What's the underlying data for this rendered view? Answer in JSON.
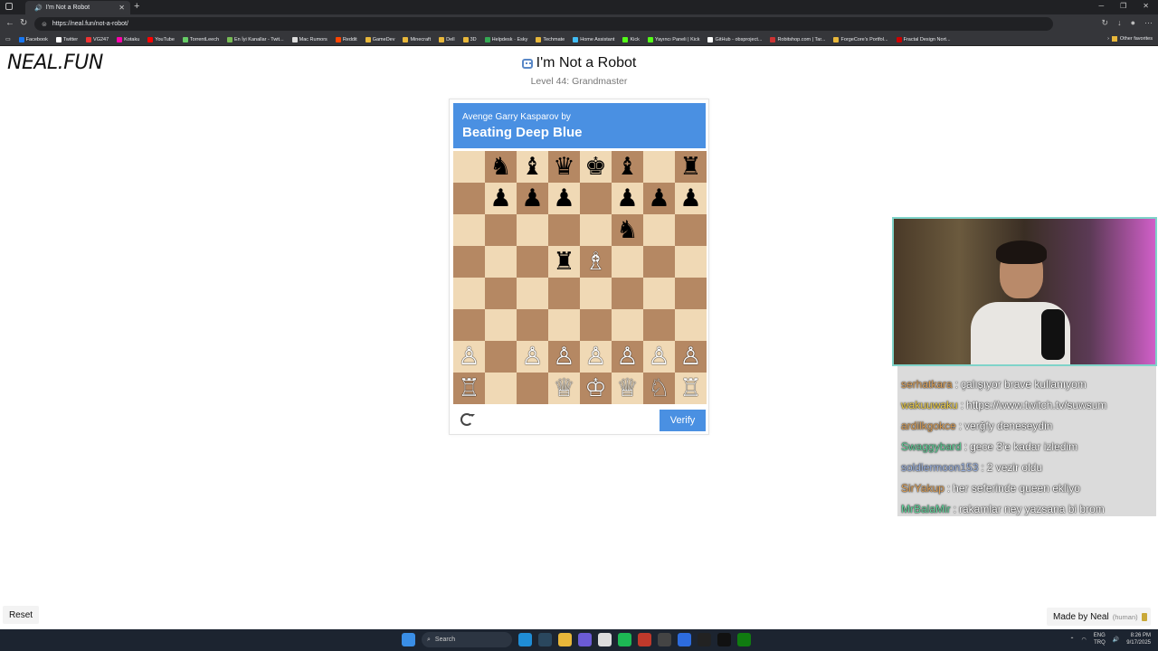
{
  "browser": {
    "tab_title": "I'm Not a Robot",
    "url": "https://neal.fun/not-a-robot/",
    "bookmarks": [
      "Facebook",
      "Twitter",
      "VG247",
      "Kotaku",
      "YouTube",
      "TorrentLeech",
      "En İyi Kanallar - Twit...",
      "Mac Rumors",
      "Reddit",
      "GameDev",
      "Minecraft",
      "Dell",
      "3D",
      "Helpdesk · Esky",
      "Techmate",
      "Home Assistant",
      "Kick",
      "Yayıncı Paneli | Kick",
      "GitHub - obsproject...",
      "Robitshop.com | Tar...",
      "ForgeCore's Portfol...",
      "Fractal Design Nort..."
    ],
    "other_favorites": "Other favorites"
  },
  "page": {
    "logo": "NEAL.FUN",
    "title": "I'm Not a Robot",
    "subtitle": "Level 44: Grandmaster",
    "banner_small": "Avenge Garry Kasparov by",
    "banner_big": "Beating Deep Blue",
    "verify_label": "Verify",
    "reset_label": "Reset",
    "made_by": "Made by Neal",
    "made_by_note": "(human)"
  },
  "board": [
    [
      "",
      "bn",
      "bb",
      "bq",
      "bk",
      "bb",
      "",
      "br"
    ],
    [
      "",
      "bp",
      "bp",
      "bp",
      "",
      "bp",
      "bp",
      "bp"
    ],
    [
      "",
      "",
      "",
      "",
      "",
      "bn",
      "",
      ""
    ],
    [
      "",
      "",
      "",
      "br",
      "wb",
      "",
      "",
      ""
    ],
    [
      "",
      "",
      "",
      "",
      "",
      "",
      "",
      ""
    ],
    [
      "",
      "",
      "",
      "",
      "",
      "",
      "",
      ""
    ],
    [
      "wp",
      "",
      "wp",
      "wp",
      "wp",
      "wp",
      "wp",
      "wp"
    ],
    [
      "wr",
      "",
      "",
      "wq",
      "wk",
      "wq",
      "wn",
      "wr"
    ]
  ],
  "piece_glyphs": {
    "bk": "♚",
    "bq": "♛",
    "br": "♜",
    "bb": "♝",
    "bn": "♞",
    "bp": "♟",
    "wk": "♔",
    "wq": "♕",
    "wr": "♖",
    "wb": "♗",
    "wn": "♘",
    "wp": "♙"
  },
  "colors": {
    "accent": "#4a90e2",
    "light_square": "#f0d9b5",
    "dark_square": "#b58863"
  },
  "chat": [
    {
      "user": "serhatkara",
      "color": "#e0a35a",
      "message": "çalışıyor brave kullanıyom"
    },
    {
      "user": "wakuuwaku",
      "color": "#f2d14a",
      "message": "https://www.twitch.tv/suwsum"
    },
    {
      "user": "ardilkgokce",
      "color": "#e0a35a",
      "message": "verğfy deneseydin"
    },
    {
      "user": "Swaggybard",
      "color": "#5fd39a",
      "message": "gece 3'e kadar izledim"
    },
    {
      "user": "soldiermoon153",
      "color": "#9fb8e8",
      "message": "2 vezir oldu"
    },
    {
      "user": "SirYakup",
      "color": "#e0a35a",
      "message": "her seferinde queen ekliyo"
    },
    {
      "user": "MrBalaMir",
      "color": "#5fd39a",
      "message": "rakamlar ney yazsana bi brom"
    }
  ],
  "taskbar": {
    "search_label": "Search",
    "lang": "ENG",
    "region": "TRQ",
    "time": "8:26 PM",
    "date": "9/17/2025"
  }
}
